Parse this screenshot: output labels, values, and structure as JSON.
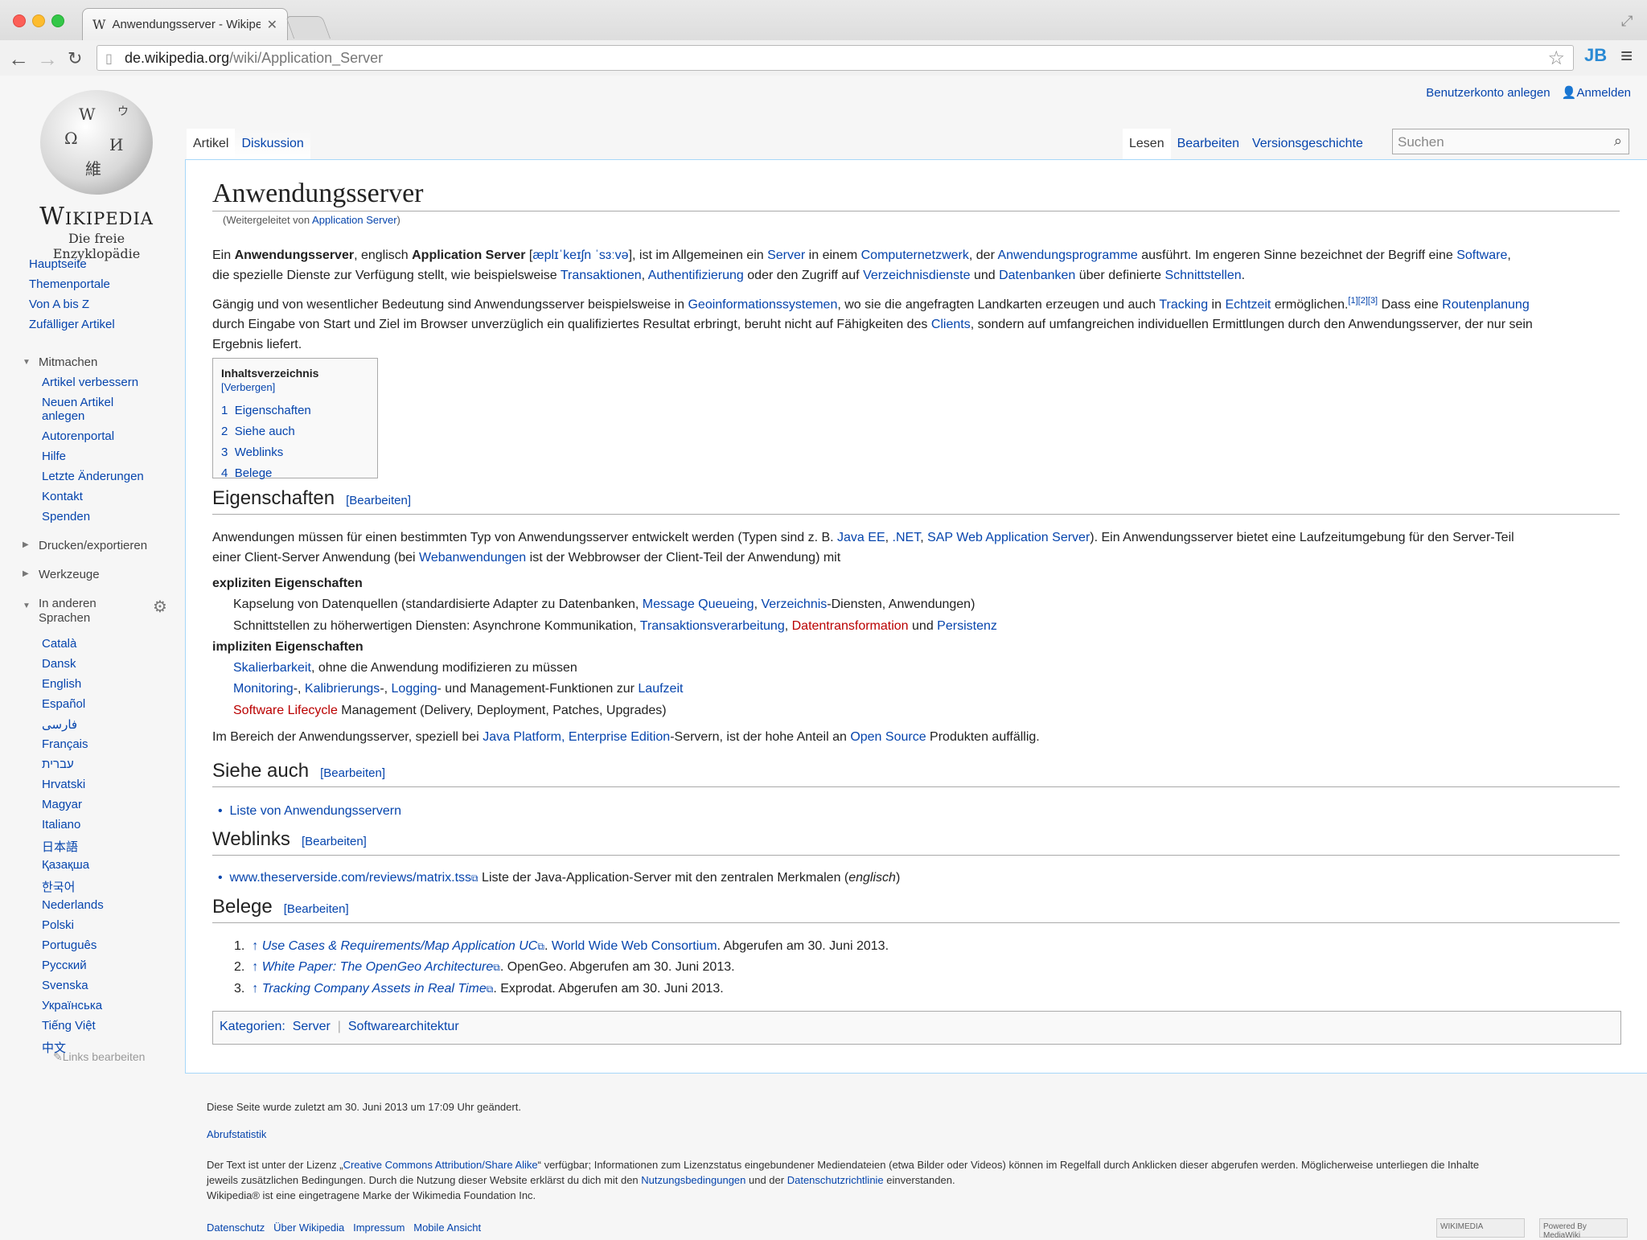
{
  "browser": {
    "tab_title": "Anwendungsserver - Wikipedia",
    "tab_icon": "W",
    "url_domain": "de.wikipedia.org",
    "url_path": "/wiki/Application_Server",
    "extension": "JB"
  },
  "logo": {
    "name": "Wikipedia",
    "subtitle": "Die freie Enzyklopädie"
  },
  "personal": {
    "create": "Benutzerkonto anlegen",
    "login": "Anmelden"
  },
  "tabs": {
    "article": "Artikel",
    "talk": "Diskussion",
    "read": "Lesen",
    "edit": "Bearbeiten",
    "history": "Versionsgeschichte",
    "search_placeholder": "Suchen"
  },
  "sidebar": {
    "main": [
      "Hauptseite",
      "Themenportale",
      "Von A bis Z",
      "Zufälliger Artikel"
    ],
    "participate_head": "Mitmachen",
    "participate": [
      "Artikel verbessern",
      "Neuen Artikel",
      "anlegen",
      "Autorenportal",
      "Hilfe",
      "Letzte Änderungen",
      "Kontakt",
      "Spenden"
    ],
    "print": "Drucken/exportieren",
    "tools": "Werkzeuge",
    "lang_head1": "In anderen",
    "lang_head2": "Sprachen",
    "langs": [
      "Català",
      "Dansk",
      "English",
      "Español",
      "فارسی",
      "Français",
      "עברית",
      "Hrvatski",
      "Magyar",
      "Italiano",
      "日本語",
      "Қазақша",
      "한국어",
      "Nederlands",
      "Polski",
      "Português",
      "Русский",
      "Svenska",
      "Українська",
      "Tiếng Việt",
      "中文"
    ],
    "edit_links": "Links bearbeiten"
  },
  "article": {
    "title": "Anwendungsserver",
    "redirect_pre": "(Weitergeleitet von ",
    "redirect_link": "Application Server",
    "redirect_post": ")",
    "p1": {
      "a": "Ein ",
      "b": "Anwendungsserver",
      "c": ", englisch ",
      "d": "Application Server",
      "e": " [",
      "ipa": "æplɪˈkeɪʃn ˈsɜːvə",
      "f": "], ist im Allgemeinen ein ",
      "l1": "Server",
      "g": " in einem ",
      "l2": "Computernetzwerk",
      "h": ", der ",
      "l3": "Anwendungsprogramme",
      "i": " ausführt. Im engeren Sinne bezeichnet der Begriff eine ",
      "l4": "Software",
      "j": ",",
      "line2_a": "die spezielle Dienste zur Verfügung stellt, wie beispielsweise ",
      "l5": "Transaktionen",
      "k": ", ",
      "l6": "Authentifizierung",
      "m": " oder den Zugriff auf ",
      "l7": "Verzeichnisdienste",
      "n": " und ",
      "l8": "Datenbanken",
      "o": " über definierte ",
      "l9": "Schnittstellen",
      "p": "."
    },
    "p2": {
      "a": "Gängig und von wesentlicher Bedeutung sind Anwendungsserver beispielsweise in ",
      "l1": "Geoinformationssystemen",
      "b": ", wo sie die angefragten Landkarten erzeugen und auch ",
      "l2": "Tracking",
      "c": " in ",
      "l3": "Echtzeit",
      "d": " ermöglichen.",
      "refs": "[1][2][3]",
      "e": " Dass eine ",
      "l4": "Routenplanung",
      "line2": "durch Eingabe von Start und Ziel im Browser unverzüglich ein qualifiziertes Resultat erbringt, beruht nicht auf Fähigkeiten des ",
      "l5": "Clients",
      "f": ", sondern auf umfangreichen individuellen Ermittlungen durch den Anwendungsserver, der nur sein",
      "line3": "Ergebnis liefert."
    },
    "toc": {
      "title": "Inhaltsverzeichnis",
      "hide": "[Verbergen]",
      "items": [
        {
          "n": "1",
          "t": "Eigenschaften"
        },
        {
          "n": "2",
          "t": "Siehe auch"
        },
        {
          "n": "3",
          "t": "Weblinks"
        },
        {
          "n": "4",
          "t": "Belege"
        }
      ]
    },
    "edit_label": "[Bearbeiten]",
    "h_props": "Eigenschaften",
    "p3": {
      "a": "Anwendungen müssen für einen bestimmten Typ von Anwendungsserver entwickelt werden (Typen sind z. B. ",
      "l1": "Java EE",
      "b": ", ",
      "l2": ".NET",
      "c": ", ",
      "l3": "SAP Web Application Server",
      "d": "). Ein Anwendungsserver bietet eine Laufzeitumgebung für den Server-Teil",
      "line2_a": "einer Client-Server Anwendung (bei ",
      "l4": "Webanwendungen",
      "e": " ist der Webbrowser der Client-Teil der Anwendung) mit"
    },
    "explicit": "expliziten Eigenschaften",
    "ex1": {
      "a": "Kapselung von Datenquellen (standardisierte Adapter zu Datenbanken, ",
      "l1": "Message Queueing",
      "b": ", ",
      "l2": "Verzeichnis",
      "c": "-Diensten, Anwendungen)"
    },
    "ex2": {
      "a": "Schnittstellen zu höherwertigen Diensten: Asynchrone Kommunikation, ",
      "l1": "Transaktionsverarbeitung",
      "b": ", ",
      "r1": "Datentransformation",
      "c": " und ",
      "l2": "Persistenz"
    },
    "implicit": "impliziten Eigenschaften",
    "im1": {
      "l1": "Skalierbarkeit",
      "a": ", ohne die Anwendung modifizieren zu müssen"
    },
    "im2": {
      "l1": "Monitoring",
      "a": "-, ",
      "l2": "Kalibrierungs",
      "b": "-, ",
      "l3": "Logging",
      "c": "- und Management-Funktionen zur ",
      "l4": "Laufzeit"
    },
    "im3": {
      "r1": "Software Lifecycle",
      "a": " Management (Delivery, Deployment, Patches, Upgrades)"
    },
    "p4": {
      "a": "Im Bereich der Anwendungsserver, speziell bei ",
      "l1": "Java Platform, Enterprise Edition",
      "b": "-Servern, ist der hohe Anteil an ",
      "l2": "Open Source",
      "c": " Produkten auffällig."
    },
    "h_see": "Siehe auch",
    "see1": "Liste von Anwendungsservern",
    "h_web": "Weblinks",
    "web1_link": "www.theserverside.com/reviews/matrix.tss",
    "web1_a": " Liste der Java-Application-Server mit den zentralen Merkmalen (",
    "web1_it": "englisch",
    "web1_b": ")",
    "h_refs": "Belege",
    "refs": [
      {
        "n": "1.",
        "link": "Use Cases & Requirements/Map Application UC",
        "a": ". ",
        "l2": "World Wide Web Consortium",
        "b": ". Abgerufen am 30. Juni 2013."
      },
      {
        "n": "2.",
        "link": "White Paper: The OpenGeo Architecture",
        "a": ". OpenGeo. Abgerufen am 30. Juni 2013.",
        "l2": "",
        "b": ""
      },
      {
        "n": "3.",
        "link": "Tracking Company Assets in Real Time",
        "a": ". Exprodat. Abgerufen am 30. Juni 2013.",
        "l2": "",
        "b": ""
      }
    ],
    "cat_label": "Kategorien:",
    "cats": [
      "Server",
      "Softwarearchitektur"
    ]
  },
  "footer": {
    "changed": "Diese Seite wurde zuletzt am 30. Juni 2013 um 17:09 Uhr geändert.",
    "stats": "Abrufstatistik",
    "lic_a": "Der Text ist unter der Lizenz „",
    "lic_link": "Creative Commons Attribution/Share Alike",
    "lic_b": "“ verfügbar; Informationen zum Lizenzstatus eingebundener Mediendateien (etwa Bilder oder Videos) können im Regelfall durch Anklicken dieser abgerufen werden. Möglicherweise unterliegen die Inhalte",
    "lic_c": "jeweils zusätzlichen Bedingungen. Durch die Nutzung dieser Website erklärst du dich mit den ",
    "terms": "Nutzungsbedingungen",
    "lic_d": " und der ",
    "privacy_link": "Datenschutzrichtlinie",
    "lic_e": " einverstanden.",
    "tm": "Wikipedia® ist eine eingetragene Marke der Wikimedia Foundation Inc.",
    "links": [
      "Datenschutz",
      "Über Wikipedia",
      "Impressum",
      "Mobile Ansicht"
    ],
    "badge1": "WIKIMEDIA",
    "badge2": "Powered By MediaWiki"
  }
}
